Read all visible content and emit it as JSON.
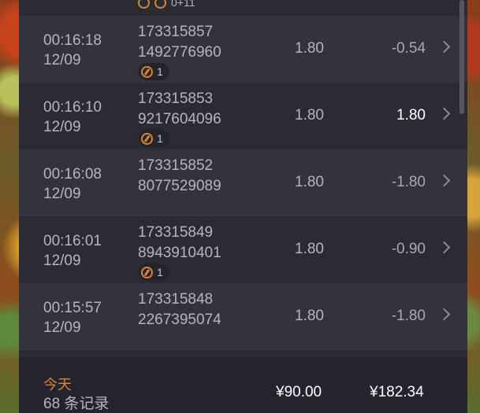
{
  "top_partial": {
    "badge_text": "0+11"
  },
  "rows": [
    {
      "time": "00:16:18",
      "date": "12/09",
      "order_line1": "173315857",
      "order_line2": "1492776960",
      "badge": "1",
      "odds": "1.80",
      "win": "-0.54"
    },
    {
      "time": "00:16:10",
      "date": "12/09",
      "order_line1": "173315853",
      "order_line2": "9217604096",
      "badge": "1",
      "odds": "1.80",
      "win": "1.80"
    },
    {
      "time": "00:16:08",
      "date": "12/09",
      "order_line1": "173315852",
      "order_line2": "8077529089",
      "badge": "",
      "odds": "1.80",
      "win": "-1.80"
    },
    {
      "time": "00:16:01",
      "date": "12/09",
      "order_line1": "173315849",
      "order_line2": "8943910401",
      "badge": "1",
      "odds": "1.80",
      "win": "-0.90"
    },
    {
      "time": "00:15:57",
      "date": "12/09",
      "order_line1": "173315848",
      "order_line2": "2267395074",
      "badge": "",
      "odds": "1.80",
      "win": "-1.80"
    }
  ],
  "footer": {
    "today_label": "今天",
    "record_count": "68 条记录",
    "total_bet": "¥90.00",
    "total_win": "¥182.34"
  },
  "colors": {
    "accent": "#d9843a",
    "positive_win": "#ffffff"
  }
}
